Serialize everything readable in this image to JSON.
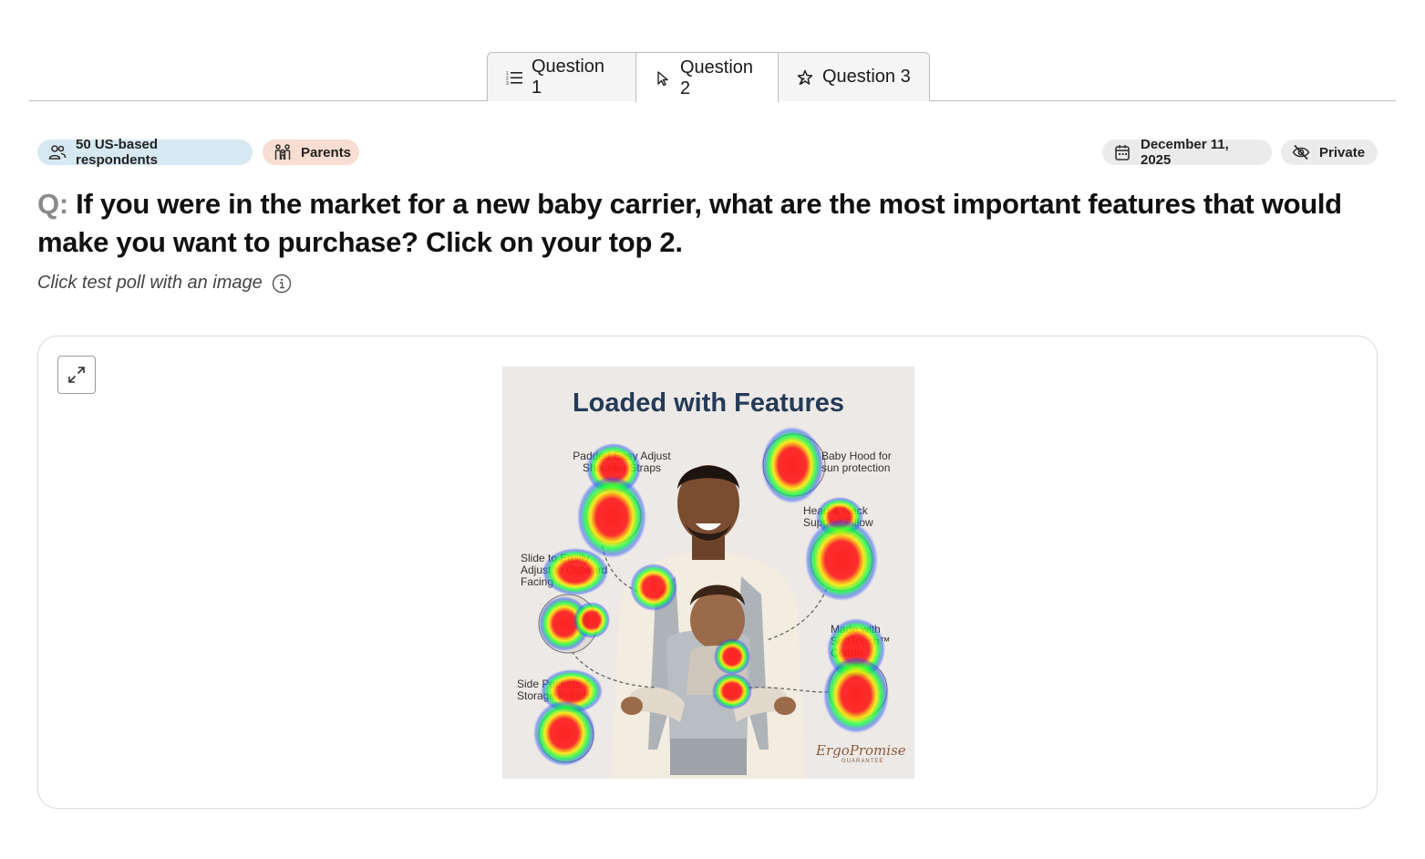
{
  "tabs": [
    {
      "label": "Question 1",
      "icon": "numbered-list-icon",
      "active": false
    },
    {
      "label": "Question 2",
      "icon": "cursor-pointer-icon",
      "active": true
    },
    {
      "label": "Question 3",
      "icon": "star-cursor-icon",
      "active": false
    }
  ],
  "chips": {
    "respondents": "50 US-based respondents",
    "audience": "Parents",
    "date": "December 11, 2025",
    "visibility": "Private"
  },
  "question": {
    "prefix": "Q:",
    "text": "If you were in the market for a new baby carrier, what are the most important features that would make you want to purchase? Click on your top 2.",
    "subtitle": "Click test poll with an image"
  },
  "image": {
    "title": "Loaded with Features",
    "features": [
      "Padded Easy Adjust Shoulder Straps",
      "Baby Hood for sun protection",
      "Head & Neck Support Pillow",
      "Slide to Easily Adjust to Outward Facing",
      "Made with SoftTouch™ Cotton",
      "Side Pockets & Storage Pouch"
    ],
    "brand": "ErgoPromise",
    "brand_sub": "GUARANTEE"
  },
  "colors": {
    "chip_respondents": "#d6e9f2",
    "chip_parents": "#f7ddd2",
    "chip_neutral": "#ebebeb",
    "heat_high": "#ff1a1a",
    "heat_mid": "#ffff00",
    "heat_low": "#00ff40",
    "heat_edge": "#3050ff"
  }
}
